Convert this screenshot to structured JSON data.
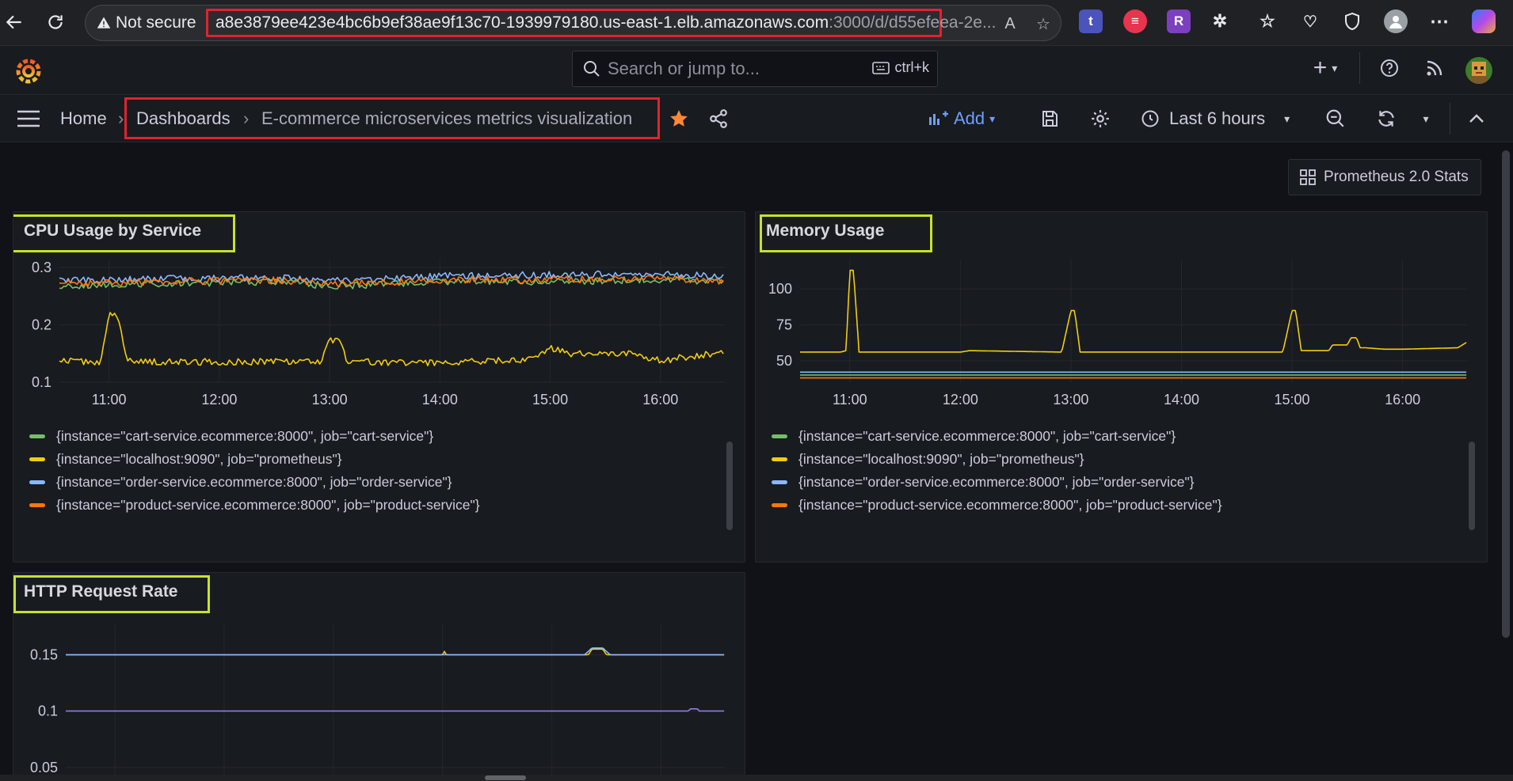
{
  "browser": {
    "not_secure": "Not secure",
    "url_host": "a8e3879ee423e4bc6b9ef38ae9f13c70-1939979180.us-east-1.elb.amazonaws.com",
    "url_rest": ":3000/d/d55efeea-2e...",
    "extensions": [
      {
        "name": "t",
        "color": "#4b53bc"
      },
      {
        "name": "≡",
        "color": "#e8344e"
      },
      {
        "name": "R",
        "color": "#7b3fbf"
      }
    ]
  },
  "topbar": {
    "search_placeholder": "Search or jump to...",
    "search_shortcut": "ctrl+k",
    "add_plus": "+"
  },
  "subbar": {
    "home": "Home",
    "sep": "›",
    "dashboards": "Dashboards",
    "dashboard_title": "E-commerce microservices metrics visualization",
    "add_label": "Add",
    "time_range": "Last 6 hours"
  },
  "dashboard": {
    "link_label": "Prometheus 2.0 Stats"
  },
  "colors": {
    "green": "#73bf69",
    "yellow": "#f2cc0c",
    "blue": "#8ab8ff",
    "orange": "#ff780a",
    "purple": "#8f7ee7",
    "highlight_red": "#e0232d",
    "highlight_lime": "#c6e22b"
  },
  "legend": [
    {
      "label": "{instance=\"cart-service.ecommerce:8000\", job=\"cart-service\"}",
      "color": "#73bf69"
    },
    {
      "label": "{instance=\"localhost:9090\", job=\"prometheus\"}",
      "color": "#f2cc0c"
    },
    {
      "label": "{instance=\"order-service.ecommerce:8000\", job=\"order-service\"}",
      "color": "#8ab8ff"
    },
    {
      "label": "{instance=\"product-service.ecommerce:8000\", job=\"product-service\"}",
      "color": "#ff780a"
    }
  ],
  "panels": {
    "cpu": {
      "title": "CPU Usage by Service"
    },
    "memory": {
      "title": "Memory Usage"
    },
    "http": {
      "title": "HTTP Request Rate"
    }
  },
  "chart_data": [
    {
      "type": "line",
      "title": "CPU Usage by Service",
      "x_ticks": [
        "11:00",
        "12:00",
        "13:00",
        "14:00",
        "15:00",
        "16:00"
      ],
      "y_ticks": [
        "0.3",
        "0.2",
        "0.1"
      ],
      "ylim": [
        0.1,
        0.3
      ],
      "x_range": [
        "10:33",
        "16:35"
      ],
      "series": [
        {
          "name": "{instance=\"cart-service.ecommerce:8000\", job=\"cart-service\"}",
          "color": "#73bf69",
          "x": [
            "10:33",
            "11:30",
            "12:30",
            "13:00",
            "13:30",
            "14:00",
            "14:30",
            "15:00",
            "15:30",
            "16:00",
            "16:35"
          ],
          "values": [
            0.268,
            0.272,
            0.275,
            0.268,
            0.27,
            0.275,
            0.276,
            0.274,
            0.277,
            0.279,
            0.275
          ]
        },
        {
          "name": "{instance=\"localhost:9090\", job=\"prometheus\"}",
          "color": "#f2cc0c",
          "x": [
            "10:33",
            "10:55",
            "11:00",
            "11:05",
            "11:10",
            "12:00",
            "12:55",
            "13:00",
            "13:05",
            "13:10",
            "14:00",
            "14:50",
            "15:00",
            "15:10",
            "15:30",
            "15:45",
            "16:00",
            "16:35"
          ],
          "values": [
            0.137,
            0.135,
            0.218,
            0.216,
            0.137,
            0.135,
            0.136,
            0.175,
            0.172,
            0.136,
            0.134,
            0.14,
            0.16,
            0.15,
            0.148,
            0.15,
            0.138,
            0.152
          ]
        },
        {
          "name": "{instance=\"order-service.ecommerce:8000\", job=\"order-service\"}",
          "color": "#8ab8ff",
          "x": [
            "10:33",
            "11:30",
            "12:30",
            "13:00",
            "13:30",
            "14:00",
            "14:30",
            "15:00",
            "15:30",
            "16:00",
            "16:35"
          ],
          "values": [
            0.277,
            0.28,
            0.282,
            0.276,
            0.28,
            0.285,
            0.286,
            0.287,
            0.288,
            0.29,
            0.283
          ]
        },
        {
          "name": "{instance=\"product-service.ecommerce:8000\", job=\"product-service\"}",
          "color": "#ff780a",
          "x": [
            "10:33",
            "11:30",
            "12:30",
            "13:00",
            "13:30",
            "14:00",
            "14:30",
            "15:00",
            "15:30",
            "16:00",
            "16:35"
          ],
          "values": [
            0.272,
            0.275,
            0.278,
            0.272,
            0.274,
            0.278,
            0.279,
            0.278,
            0.28,
            0.282,
            0.276
          ]
        }
      ]
    },
    {
      "type": "line",
      "title": "Memory Usage",
      "x_ticks": [
        "11:00",
        "12:00",
        "13:00",
        "14:00",
        "15:00",
        "16:00"
      ],
      "y_ticks": [
        "100",
        "75",
        "50"
      ],
      "ylim": [
        35,
        115
      ],
      "x_range": [
        "10:33",
        "16:35"
      ],
      "series": [
        {
          "name": "{instance=\"localhost:9090\", job=\"prometheus\"}",
          "color": "#f2cc0c",
          "x": [
            "10:33",
            "10:55",
            "10:58",
            "11:00",
            "11:02",
            "11:05",
            "11:30",
            "12:00",
            "12:05",
            "12:55",
            "13:00",
            "13:02",
            "13:05",
            "13:30",
            "14:00",
            "14:55",
            "15:00",
            "15:02",
            "15:05",
            "15:20",
            "15:22",
            "15:30",
            "15:32",
            "15:35",
            "15:37",
            "15:40",
            "15:50",
            "16:00",
            "16:30",
            "16:35"
          ],
          "values": [
            56,
            56,
            57,
            113,
            113,
            56,
            56,
            56,
            57,
            56,
            85,
            85,
            56,
            56,
            56,
            56,
            85,
            85,
            57,
            57,
            61,
            61,
            66,
            66,
            59,
            59,
            58,
            58,
            59,
            63
          ]
        },
        {
          "name": "{instance=\"order-service.ecommerce:8000\", job=\"order-service\"}",
          "color": "#8ab8ff",
          "x": [
            "10:33",
            "16:35"
          ],
          "values": [
            42,
            42
          ]
        },
        {
          "name": "{instance=\"cart-service.ecommerce:8000\", job=\"cart-service\"}",
          "color": "#73bf69",
          "x": [
            "10:33",
            "16:35"
          ],
          "values": [
            40,
            40
          ]
        },
        {
          "name": "{instance=\"product-service.ecommerce:8000\", job=\"product-service\"}",
          "color": "#ff780a",
          "x": [
            "10:33",
            "16:35"
          ],
          "values": [
            38,
            38
          ]
        }
      ]
    },
    {
      "type": "line",
      "title": "HTTP Request Rate",
      "y_ticks": [
        "0.15",
        "0.1",
        "0.05"
      ],
      "ylim": [
        0.04,
        0.17
      ],
      "x_range": [
        "10:33",
        "16:35"
      ],
      "series": [
        {
          "color": "#f2cc0c",
          "x": [
            "10:33",
            "14:00",
            "14:01",
            "14:02",
            "15:00",
            "15:20",
            "15:22",
            "15:28",
            "15:30",
            "16:35"
          ],
          "values": [
            0.15,
            0.15,
            0.153,
            0.15,
            0.15,
            0.15,
            0.155,
            0.155,
            0.15,
            0.15
          ]
        },
        {
          "color": "#8ab8ff",
          "x": [
            "10:33",
            "15:18",
            "15:22",
            "15:28",
            "15:32",
            "16:35"
          ],
          "values": [
            0.15,
            0.15,
            0.156,
            0.156,
            0.15,
            0.15
          ]
        },
        {
          "color": "#8f7ee7",
          "x": [
            "10:33",
            "16:15",
            "16:16",
            "16:20",
            "16:21",
            "16:35"
          ],
          "values": [
            0.1,
            0.1,
            0.102,
            0.102,
            0.1,
            0.1
          ]
        }
      ]
    }
  ]
}
